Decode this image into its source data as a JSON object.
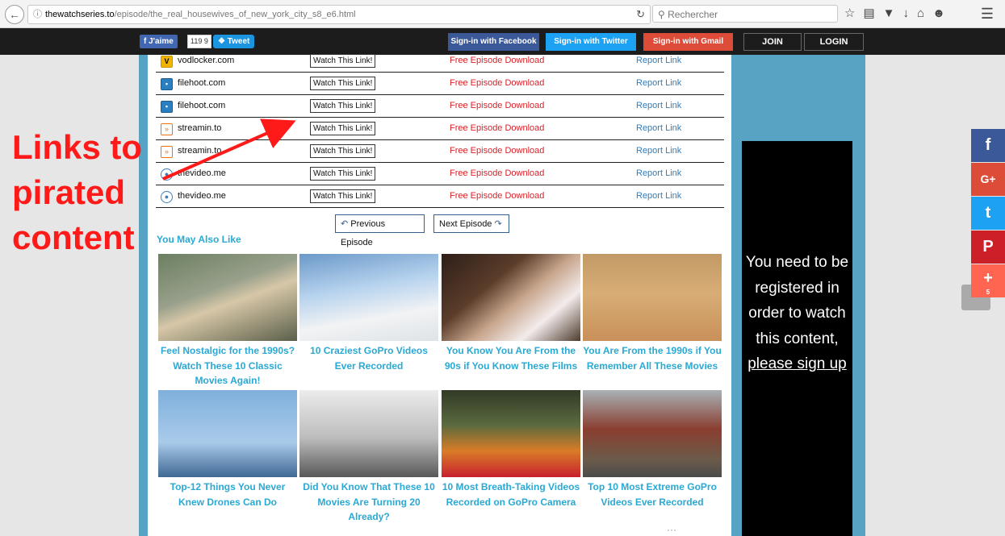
{
  "browser": {
    "url_host": "thewatchseries.to",
    "url_path": "/episode/the_real_housewives_of_new_york_city_s8_e6.html",
    "search_placeholder": "Rechercher"
  },
  "site_bar": {
    "fb_like": "J'aime",
    "like_count": "119 9",
    "tweet": "Tweet",
    "sign_fb": "Sign-in with Facebook",
    "sign_tw": "Sign-in with Twitter",
    "sign_gm": "Sign-in with Gmail",
    "join": "JOIN",
    "login": "LOGIN"
  },
  "links": [
    {
      "host": "vodlocker.com",
      "watch": "Watch This Link!",
      "download": "Free Episode Download",
      "report": "Report Link",
      "icon": "vodlocker-icon"
    },
    {
      "host": "filehoot.com",
      "watch": "Watch This Link!",
      "download": "Free Episode Download",
      "report": "Report Link",
      "icon": "filehoot-icon"
    },
    {
      "host": "filehoot.com",
      "watch": "Watch This Link!",
      "download": "Free Episode Download",
      "report": "Report Link",
      "icon": "filehoot-icon"
    },
    {
      "host": "streamin.to",
      "watch": "Watch This Link!",
      "download": "Free Episode Download",
      "report": "Report Link",
      "icon": "streamin-icon"
    },
    {
      "host": "streamin.to",
      "watch": "Watch This Link!",
      "download": "Free Episode Download",
      "report": "Report Link",
      "icon": "streamin-icon"
    },
    {
      "host": "thevideo.me",
      "watch": "Watch This Link!",
      "download": "Free Episode Download",
      "report": "Report Link",
      "icon": "thevideo-icon"
    },
    {
      "host": "thevideo.me",
      "watch": "Watch This Link!",
      "download": "Free Episode Download",
      "report": "Report Link",
      "icon": "thevideo-icon"
    }
  ],
  "episode_nav": {
    "previous": "Previous Episode",
    "next": "Next Episode"
  },
  "also_like": {
    "heading": "You May Also Like",
    "cards": [
      {
        "caption": "Feel Nostalgic for the 1990s? Watch These 10 Classic Movies Again!"
      },
      {
        "caption": "10 Craziest GoPro Videos Ever Recorded"
      },
      {
        "caption": "You Know You Are From the 90s if You Know These Films"
      },
      {
        "caption": "You Are From the 1990s if You Remember All These Movies"
      },
      {
        "caption": "Top-12 Things You Never Knew Drones Can Do"
      },
      {
        "caption": "Did You Know That These 10 Movies Are Turning 20 Already?"
      },
      {
        "caption": "10 Most Breath-Taking Videos Recorded on GoPro Camera"
      },
      {
        "caption": "Top 10 Most Extreme GoPro Videos Ever Recorded"
      }
    ]
  },
  "promo": {
    "text": "You need to be registered in order to watch this content,",
    "signup": "please sign up"
  },
  "share": {
    "facebook": "f",
    "google": "G+",
    "twitter": "t",
    "pinterest": "P",
    "more": "+",
    "count": "5"
  },
  "annotation": {
    "text": "Links to\npirated\ncontent",
    "color": "#ff1a1a"
  }
}
